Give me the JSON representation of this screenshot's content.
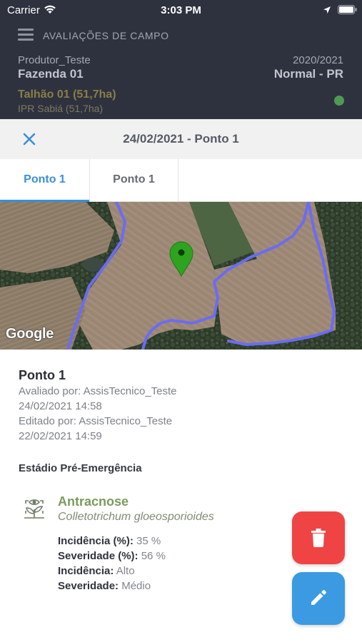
{
  "status_bar": {
    "carrier": "Carrier",
    "time": "3:03 PM"
  },
  "header": {
    "title": "AVALIAÇÕES DE CAMPO",
    "producer": "Produtor_Teste",
    "farm": "Fazenda 01",
    "season": "2020/2021",
    "type": "Normal - PR",
    "plot": "Talhão 01 (51,7ha)",
    "cultivar": "IPR Sabiá (51,7ha)",
    "status_color": "#4f9a52"
  },
  "sheet": {
    "title": "24/02/2021 - Ponto 1"
  },
  "tabs": [
    {
      "label": "Ponto 1",
      "active": true
    },
    {
      "label": "Ponto 1",
      "active": false
    }
  ],
  "map": {
    "attribution": "Google",
    "marker_color": "#2ea31f",
    "boundary_color": "#6b6cf2"
  },
  "point": {
    "name": "Ponto 1",
    "evaluated_by": "Avaliado por: AssisTecnico_Teste",
    "evaluated_at": "24/02/2021 14:58",
    "edited_by": "Editado por: AssisTecnico_Teste",
    "edited_at": "22/02/2021 14:59"
  },
  "stage": "Estádio Pré-Emergência",
  "disease": {
    "icon": "leaf-eye-icon",
    "name": "Antracnose",
    "scientific_name": "Colletotrichum gloeosporioides",
    "metrics": [
      {
        "label": "Incidência (%):",
        "value": "35 %"
      },
      {
        "label": "Severidade (%):",
        "value": "56 %"
      },
      {
        "label": "Incidência:",
        "value": "Alto"
      },
      {
        "label": "Severidade:",
        "value": "Médio"
      }
    ]
  },
  "actions": {
    "delete": {
      "icon": "trash-icon",
      "color": "#f04444"
    },
    "edit": {
      "icon": "pencil-icon",
      "color": "#3b9ae2"
    }
  }
}
